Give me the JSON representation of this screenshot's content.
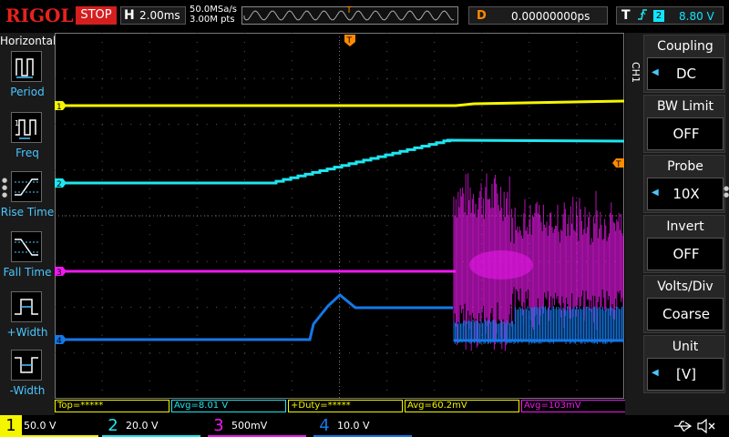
{
  "header": {
    "logo": "RIGOL",
    "run_state": "STOP",
    "horizontal_label": "H",
    "timebase": "2.00ms",
    "sample_rate": "50.0MSa/s",
    "memory_depth": "3.00M pts",
    "trigger_position_marker": "T",
    "delay_label": "D",
    "delay_value": "0.00000000ps",
    "trigger_label": "T",
    "trigger_edge": "rising-edge-icon",
    "trigger_source": "2",
    "trigger_level": "8.80 V"
  },
  "left_menu": {
    "title": "Horizontal",
    "items": [
      {
        "label": "Period",
        "icon": "period-icon"
      },
      {
        "label": "Freq",
        "icon": "frequency-icon"
      },
      {
        "label": "Rise Time",
        "icon": "rise-time-icon"
      },
      {
        "label": "Fall Time",
        "icon": "fall-time-icon"
      },
      {
        "label": "+Width",
        "icon": "positive-width-icon"
      },
      {
        "label": "-Width",
        "icon": "negative-width-icon"
      }
    ]
  },
  "right_menu": {
    "channel_tag": "CH1",
    "items": [
      {
        "title": "Coupling",
        "value": "DC",
        "has_arrow": true
      },
      {
        "title": "BW Limit",
        "value": "OFF",
        "has_arrow": false
      },
      {
        "title": "Probe",
        "value": "10X",
        "has_arrow": true
      },
      {
        "title": "Invert",
        "value": "OFF",
        "has_arrow": false
      },
      {
        "title": "Volts/Div",
        "value": "Coarse",
        "has_arrow": false
      },
      {
        "title": "Unit",
        "value": "[V]",
        "has_arrow": true
      }
    ]
  },
  "waveform": {
    "trigger_marker": "T",
    "channel_markers": [
      "1",
      "2",
      "3",
      "4"
    ],
    "colors": {
      "ch1": "#f5f500",
      "ch2": "#1ee6f0",
      "ch3": "#f018f0",
      "ch4": "#1478e8",
      "trigger": "#ff8a00",
      "grid": "#5a5a5a"
    }
  },
  "measurements": [
    {
      "text": "Top=*****",
      "color": "#f5f500"
    },
    {
      "text": "Avg=8.01 V",
      "color": "#1ee6f0"
    },
    {
      "text": "+Duty=*****",
      "color": "#f5f500"
    },
    {
      "text": "Avg=60.2mV",
      "color": "#f5f500"
    },
    {
      "text": "Avg=103mV",
      "color": "#f018f0"
    }
  ],
  "channels": [
    {
      "num": "1",
      "scale": "50.0 V",
      "color": "#f5f500",
      "active": true
    },
    {
      "num": "2",
      "scale": "20.0 V",
      "color": "#1ee6f0",
      "active": false
    },
    {
      "num": "3",
      "scale": "500mV",
      "color": "#f018f0",
      "active": false
    },
    {
      "num": "4",
      "scale": "10.0 V",
      "color": "#1478e8",
      "active": false
    }
  ],
  "status_icons": [
    "usb-icon",
    "speaker-mute-icon"
  ]
}
